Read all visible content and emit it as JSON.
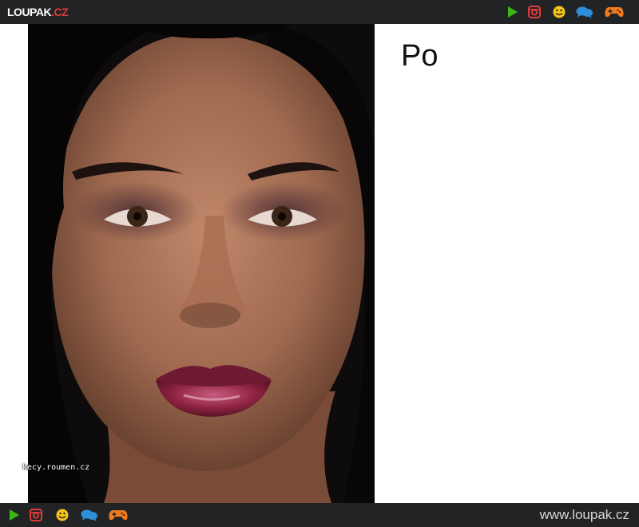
{
  "header": {
    "logo_text": "LOUPAK",
    "logo_dot": ".",
    "logo_tld": "CZ"
  },
  "nav_icons": [
    {
      "icon": "play-icon",
      "color": "#3fb618"
    },
    {
      "icon": "instagram-icon",
      "color": "#e33b3b"
    },
    {
      "icon": "smiley-icon",
      "color": "#f5c518"
    },
    {
      "icon": "chat-icon",
      "color": "#2f8fd8"
    },
    {
      "icon": "gamepad-icon",
      "color": "#f07b1f"
    }
  ],
  "content": {
    "photo_watermark": "kecy.roumen.cz",
    "caption": "Po"
  },
  "footer": {
    "site_url": "www.loupak.cz"
  }
}
